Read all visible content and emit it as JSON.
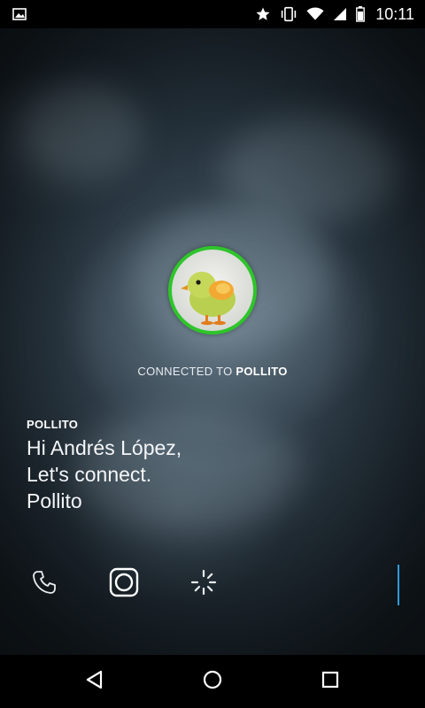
{
  "status_bar": {
    "time": "10:11",
    "icons": [
      "image-notification-icon",
      "star-icon",
      "vibrate-icon",
      "wifi-icon",
      "signal-icon",
      "battery-icon"
    ]
  },
  "contact": {
    "name": "POLLITO",
    "avatar_ring_color": "#2ec52a"
  },
  "connection": {
    "prefix": "CONNECTED TO ",
    "name": "POLLITO"
  },
  "message": {
    "sender": "POLLITO",
    "lines": [
      "Hi Andrés López,",
      "Let's connect.",
      "Pollito"
    ]
  },
  "actions": [
    "phone-icon",
    "camera-icon",
    "loading-spinner-icon"
  ],
  "accent_color": "#2f9bdc",
  "navigation": [
    "back-icon",
    "home-icon",
    "recents-icon"
  ]
}
